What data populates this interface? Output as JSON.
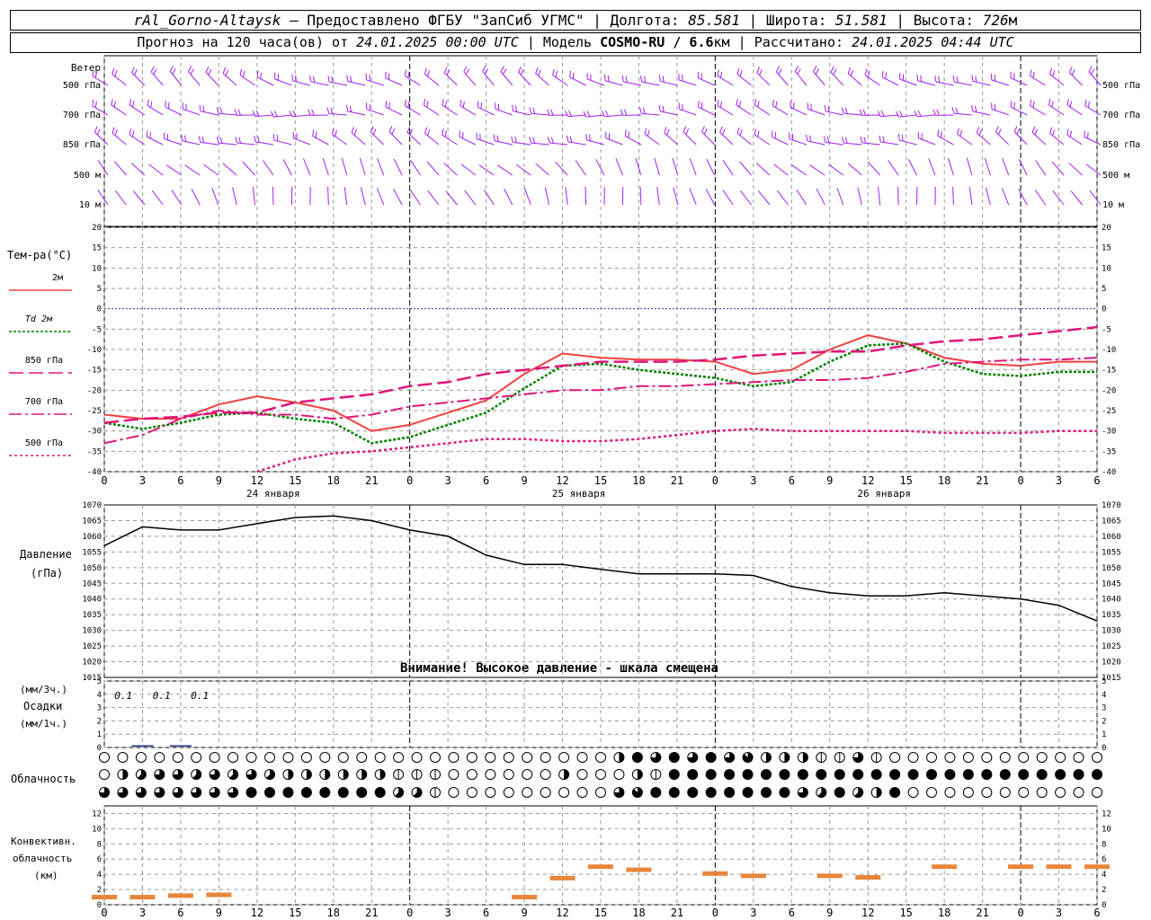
{
  "header": {
    "station": "rAl_Gorno-Altaysk",
    "provider": "Предоставлено ФГБУ \"ЗапСиб УГМС\"",
    "lon_label": "Долгота:",
    "lon": "85.581",
    "lat_label": "Широта:",
    "lat": "51.581",
    "alt_label": "Высота:",
    "alt": "726",
    "alt_unit": "м",
    "forecast_label": "Прогноз на 120 часа(ов) от",
    "forecast_start": "24.01.2025 00:00 UTC",
    "model_label": "Модель",
    "model": "COSMO-RU / 6.6",
    "model_unit": "км",
    "calc_label": "Рассчитано:",
    "calc_time": "24.01.2025 04:44 UTC"
  },
  "labels": {
    "wind": "Ветер",
    "levels": [
      "500 гПа",
      "700 гПа",
      "850 гПа",
      "500 м",
      "10 м"
    ],
    "temp_title": "Тем-ра(°C)",
    "temp_legend": [
      "2м",
      "Td 2м",
      "850 гПа",
      "700 гПа",
      "500 гПа"
    ],
    "pressure": "Давление",
    "pressure_unit": "(гПа)",
    "warning": "Внимание! Высокое давление - шкала смещена",
    "precip_unit3": "(мм/3ч.)",
    "precip": "Осадки",
    "precip_unit1": "(мм/1ч.)",
    "precip_values": [
      "0.1",
      "0.1",
      "0.1"
    ],
    "cloud": "Облачность",
    "conv": [
      "Конвективн.",
      "облачность",
      "(км)"
    ],
    "days": [
      "24 января",
      "25 января",
      "26 января"
    ]
  },
  "colors": {
    "t2m": "#f04040",
    "td2m": "#008000",
    "t850": "#e0147a",
    "t700": "#e0147a",
    "t500": "#e0147a",
    "wind": "#a020f0",
    "conv": "#e8863a",
    "zero": "#2040c0"
  },
  "chart_data": [
    {
      "type": "line",
      "title": "Тем-ра(°C)",
      "xlabel": "",
      "ylabel": "Тем-ра(°C)",
      "ylim": [
        -40,
        20
      ],
      "x_ticks": [
        "0",
        "3",
        "6",
        "9",
        "12",
        "15",
        "18",
        "21",
        "0",
        "3",
        "6",
        "9",
        "12",
        "15",
        "18",
        "21",
        "0",
        "3",
        "6",
        "9",
        "12",
        "15",
        "18",
        "21",
        "0",
        "3",
        "6"
      ],
      "y_ticks": [
        20,
        15,
        10,
        5,
        0,
        -5,
        -10,
        -15,
        -20,
        -25,
        -30,
        -35,
        -40
      ],
      "x_hours": [
        0,
        3,
        6,
        9,
        12,
        15,
        18,
        21,
        24,
        27,
        30,
        33,
        36,
        39,
        42,
        45,
        48,
        51,
        54,
        57,
        60,
        63,
        66,
        69,
        72,
        75,
        78
      ],
      "series": [
        {
          "name": "2м",
          "values": [
            -26,
            -27,
            -27,
            -23.5,
            -21.5,
            -23,
            -25,
            -30,
            -28.5,
            -25.5,
            -22.5,
            -16,
            -11,
            -12,
            -12.5,
            -12.5,
            -13,
            -16,
            -15,
            -10,
            -6.5,
            -8.5,
            -12,
            -13.5,
            -14,
            -13,
            -13
          ]
        },
        {
          "name": "Td 2м",
          "values": [
            -28,
            -29.5,
            -28,
            -26,
            -25.5,
            -27,
            -28,
            -33,
            -31.5,
            -28.5,
            -25.5,
            -19.5,
            -14,
            -13.5,
            -15,
            -16,
            -17,
            -19,
            -18,
            -13,
            -9,
            -8.5,
            -13,
            -16,
            -16.5,
            -15.5,
            -15.5
          ]
        },
        {
          "name": "850 гПа",
          "values": [
            -28,
            -27,
            -26.5,
            -25.5,
            -25.5,
            -23,
            -22,
            -21,
            -19,
            -18,
            -16,
            -15,
            -14,
            -13,
            -13,
            -13,
            -12.5,
            -11.5,
            -11,
            -10.5,
            -10.5,
            -9,
            -8,
            -7.5,
            -6.5,
            -5.5,
            -4.5
          ]
        },
        {
          "name": "700 гПа",
          "values": [
            -33,
            -31,
            -27,
            -25,
            -26,
            -26,
            -27,
            -26,
            -24,
            -23,
            -22,
            -21,
            -20,
            -20,
            -19,
            -19,
            -18.5,
            -18,
            -17.5,
            -17.5,
            -17,
            -15.5,
            -13.5,
            -13,
            -12.5,
            -12.5,
            -12
          ]
        },
        {
          "name": "500 гПа",
          "values": [
            null,
            null,
            null,
            null,
            -40,
            -37,
            -35.5,
            -35,
            -34,
            -33,
            -32,
            -32,
            -32.5,
            -32.5,
            -32,
            -31,
            -30,
            -29.5,
            -30,
            -30,
            -30,
            -30,
            -30.5,
            -30.5,
            -30.5,
            -30,
            -30
          ]
        }
      ]
    },
    {
      "type": "line",
      "title": "Давление",
      "ylabel": "Давление (гПа)",
      "ylim": [
        1015,
        1070
      ],
      "y_ticks": [
        1070,
        1065,
        1060,
        1055,
        1050,
        1045,
        1040,
        1035,
        1030,
        1025,
        1020,
        1015
      ],
      "x_hours": [
        0,
        3,
        6,
        9,
        12,
        15,
        18,
        21,
        24,
        27,
        30,
        33,
        36,
        39,
        42,
        45,
        48,
        51,
        54,
        57,
        60,
        63,
        66,
        69,
        72,
        75,
        78
      ],
      "series": [
        {
          "name": "Давление",
          "values": [
            1057,
            1063,
            1062,
            1062,
            1064,
            1066,
            1066.5,
            1065,
            1062,
            1060,
            1054,
            1051,
            1051,
            1049.5,
            1048,
            1048,
            1048,
            1047.5,
            1044,
            1042,
            1041,
            1041,
            1042,
            1041,
            1040,
            1038,
            1033
          ]
        }
      ]
    },
    {
      "type": "bar",
      "title": "Осадки",
      "ylim": [
        0,
        5
      ],
      "y_ticks": [
        5,
        4,
        3,
        2,
        1,
        0
      ],
      "x_hours": [
        3,
        6
      ],
      "values": [
        0.1,
        0.1
      ],
      "annotations": [
        "0.1",
        "0.1",
        "0.1"
      ]
    },
    {
      "type": "table",
      "title": "Облачность",
      "rows": 3,
      "columns": 55,
      "description_symbols": "octas: 0 clear, 8 overcast"
    },
    {
      "type": "bar",
      "title": "Конвективн. облачность (км)",
      "ylim": [
        0,
        13
      ],
      "y_ticks": [
        12,
        10,
        8,
        6,
        4,
        2,
        0
      ],
      "x_hours": [
        0,
        3,
        6,
        9,
        12,
        15,
        18,
        21,
        24,
        27,
        30,
        33,
        36,
        39,
        42,
        45,
        48,
        51,
        54,
        57,
        60,
        63,
        66,
        69,
        72,
        75,
        78
      ],
      "values": [
        1,
        1,
        1.2,
        1.3,
        null,
        null,
        null,
        null,
        null,
        null,
        null,
        1,
        3.5,
        5,
        4.6,
        null,
        4.1,
        3.8,
        null,
        3.8,
        3.6,
        null,
        5,
        null,
        5,
        5,
        5
      ]
    }
  ]
}
